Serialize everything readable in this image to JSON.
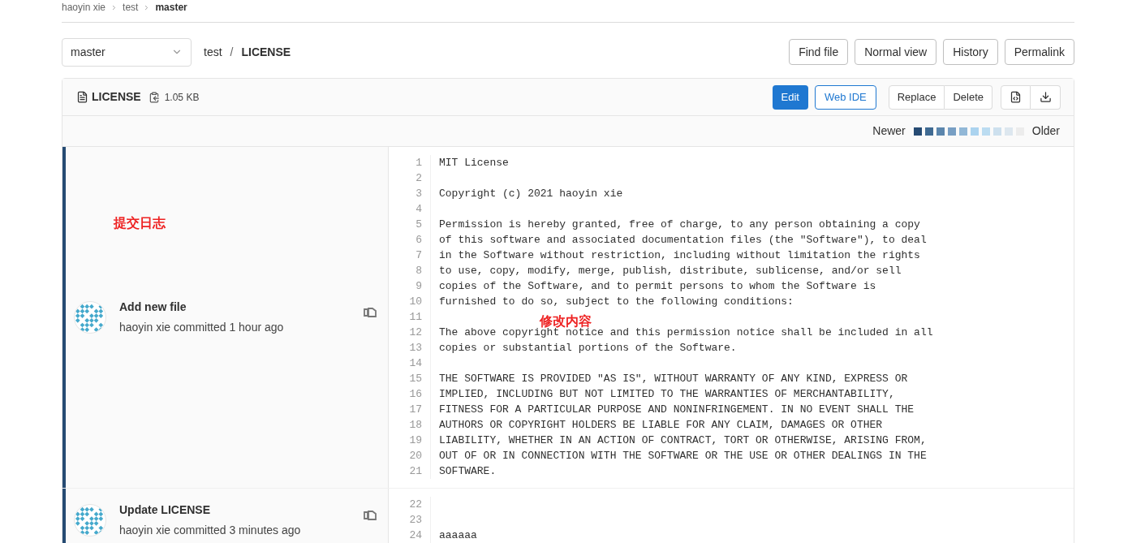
{
  "breadcrumb": [
    "haoyin xie",
    "test",
    "master"
  ],
  "branch_select": {
    "value": "master"
  },
  "path": {
    "project": "test",
    "separator": "/",
    "file": "LICENSE"
  },
  "top_buttons": [
    "Find file",
    "Normal view",
    "History",
    "Permalink"
  ],
  "file_header": {
    "name": "LICENSE",
    "size": "1.05 KB",
    "primary_button": "Edit",
    "secondary_button": "Web IDE",
    "group_buttons": [
      "Replace",
      "Delete"
    ]
  },
  "legend": {
    "newer": "Newer",
    "older": "Older",
    "swatches": [
      {
        "color": "#264b73"
      },
      {
        "color": "#3f6a92"
      },
      {
        "color": "#5b86ad"
      },
      {
        "color": "#789fc4"
      },
      {
        "color": "#92b8d7"
      },
      {
        "color": "#abd3ef"
      },
      {
        "color": "#bbdcf1"
      },
      {
        "color": "#cde0ee"
      },
      {
        "color": "#dde7ef"
      },
      {
        "color": "#ececec"
      }
    ]
  },
  "annotations": {
    "commit_log": "提交日志",
    "changes": "修改内容"
  },
  "commits": [
    {
      "title": "Add new file",
      "meta": "haoyin xie committed 1 hour ago",
      "color": "#264b73",
      "lines": [
        {
          "number": "1",
          "text": "MIT License"
        },
        {
          "number": "2"
        },
        {
          "number": "3",
          "text": "Copyright (c) 2021 haoyin xie"
        },
        {
          "number": "4"
        },
        {
          "number": "5",
          "text": "Permission is hereby granted, free of charge, to any person obtaining a copy"
        },
        {
          "number": "6",
          "text": "of this software and associated documentation files (the \"Software\"), to deal"
        },
        {
          "number": "7",
          "text": "in the Software without restriction, including without limitation the rights"
        },
        {
          "number": "8",
          "text": "to use, copy, modify, merge, publish, distribute, sublicense, and/or sell"
        },
        {
          "number": "9",
          "text": "copies of the Software, and to permit persons to whom the Software is"
        },
        {
          "number": "10",
          "text": "furnished to do so, subject to the following conditions:"
        },
        {
          "number": "11"
        },
        {
          "number": "12",
          "text": "The above copyright notice and this permission notice shall be included in all"
        },
        {
          "number": "13",
          "text": "copies or substantial portions of the Software."
        },
        {
          "number": "14"
        },
        {
          "number": "15",
          "text": "THE SOFTWARE IS PROVIDED \"AS IS\", WITHOUT WARRANTY OF ANY KIND, EXPRESS OR"
        },
        {
          "number": "16",
          "text": "IMPLIED, INCLUDING BUT NOT LIMITED TO THE WARRANTIES OF MERCHANTABILITY,"
        },
        {
          "number": "17",
          "text": "FITNESS FOR A PARTICULAR PURPOSE AND NONINFRINGEMENT. IN NO EVENT SHALL THE"
        },
        {
          "number": "18",
          "text": "AUTHORS OR COPYRIGHT HOLDERS BE LIABLE FOR ANY CLAIM, DAMAGES OR OTHER"
        },
        {
          "number": "19",
          "text": "LIABILITY, WHETHER IN AN ACTION OF CONTRACT, TORT OR OTHERWISE, ARISING FROM,"
        },
        {
          "number": "20",
          "text": "OUT OF OR IN CONNECTION WITH THE SOFTWARE OR THE USE OR OTHER DEALINGS IN THE"
        },
        {
          "number": "21",
          "text": "SOFTWARE."
        }
      ]
    },
    {
      "title": "Update LICENSE",
      "meta": "haoyin xie committed 3 minutes ago",
      "color": "#264b73",
      "lines": [
        {
          "number": "22"
        },
        {
          "number": "23"
        },
        {
          "number": "24",
          "text": "aaaaaa"
        }
      ]
    }
  ]
}
